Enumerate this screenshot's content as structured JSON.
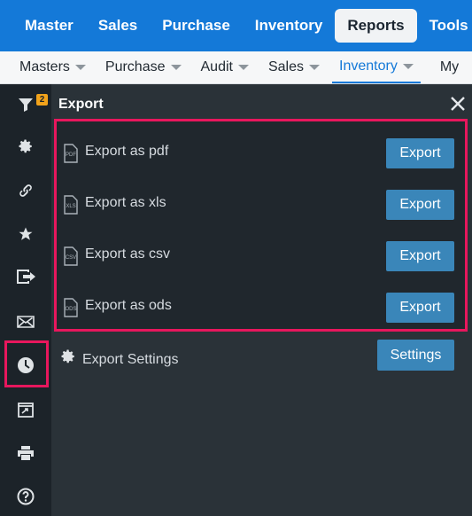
{
  "top_menu": {
    "items": [
      {
        "label": "Master"
      },
      {
        "label": "Sales"
      },
      {
        "label": "Purchase"
      },
      {
        "label": "Inventory"
      },
      {
        "label": "Reports",
        "active": true
      },
      {
        "label": "Tools"
      }
    ]
  },
  "sub_menu": {
    "items": [
      {
        "label": "Masters"
      },
      {
        "label": "Purchase"
      },
      {
        "label": "Audit"
      },
      {
        "label": "Sales"
      },
      {
        "label": "Inventory",
        "active": true
      },
      {
        "label": "My"
      }
    ]
  },
  "rail": {
    "filter_badge": "2",
    "icons": [
      "filter-icon",
      "gear-icon",
      "link-icon",
      "star-icon",
      "export-icon",
      "mail-icon",
      "clock-icon",
      "calendar-export-icon",
      "print-icon",
      "help-icon"
    ],
    "selected": "export-icon"
  },
  "panel": {
    "title": "Export",
    "close_icon": "close-icon",
    "exports": [
      {
        "label": "Export as pdf",
        "file_tag": "PDF",
        "button": "Export"
      },
      {
        "label": "Export as xls",
        "file_tag": "XLS",
        "button": "Export"
      },
      {
        "label": "Export as csv",
        "file_tag": "CSV",
        "button": "Export"
      },
      {
        "label": "Export as ods",
        "file_tag": "ODS",
        "button": "Export"
      }
    ],
    "settings": {
      "label": "Export Settings",
      "button": "Settings"
    }
  },
  "colors": {
    "top_bar": "#1479d8",
    "rail_bg": "#1c2329",
    "panel_bg": "#2a3238",
    "button": "#3a86b9",
    "highlight": "#e8175d",
    "badge": "#f2a31b"
  }
}
